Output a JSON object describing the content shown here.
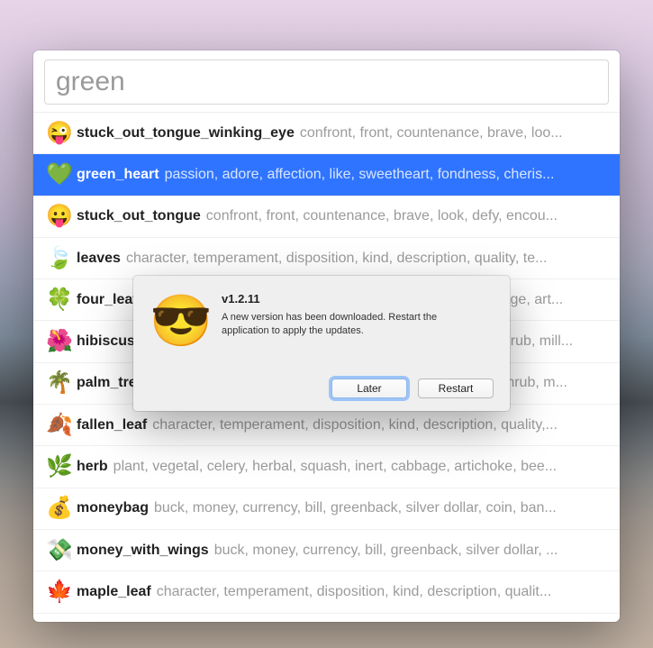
{
  "search": {
    "value": "green",
    "placeholder": ""
  },
  "rows": [
    {
      "emoji": "😜",
      "name": "stuck_out_tongue_winking_eye",
      "tags": "confront, front, countenance, brave, loo...",
      "selected": false
    },
    {
      "emoji": "💚",
      "name": "green_heart",
      "tags": "passion, adore, affection, like, sweetheart, fondness, cheris...",
      "selected": true
    },
    {
      "emoji": "😛",
      "name": "stuck_out_tongue",
      "tags": "confront, front, countenance, brave, look, defy, encou...",
      "selected": false
    },
    {
      "emoji": "🍃",
      "name": "leaves",
      "tags": "character, temperament, disposition, kind, description, quality, te...",
      "selected": false
    },
    {
      "emoji": "🍀",
      "name": "four_leaf_clover",
      "tags": "plant, vegetal, celery, herbal, squash, inert, cabbage, art...",
      "selected": false
    },
    {
      "emoji": "🌺",
      "name": "hibiscus",
      "tags": "rosiness, bush, pink, George Bush, crimson, chaparral, shrub, mill...",
      "selected": false
    },
    {
      "emoji": "🌴",
      "name": "palm_tree",
      "tags": "corner, works, shoetree, implant, flora, industrial plant, shrub, m...",
      "selected": false
    },
    {
      "emoji": "🍂",
      "name": "fallen_leaf",
      "tags": "character, temperament, disposition, kind, description, quality,...",
      "selected": false
    },
    {
      "emoji": "🌿",
      "name": "herb",
      "tags": "plant, vegetal, celery, herbal, squash, inert, cabbage, artichoke, bee...",
      "selected": false
    },
    {
      "emoji": "💰",
      "name": "moneybag",
      "tags": "buck, money, currency, bill, greenback, silver dollar, coin, ban...",
      "selected": false
    },
    {
      "emoji": "💸",
      "name": "money_with_wings",
      "tags": "buck, money, currency, bill, greenback, silver dollar, ...",
      "selected": false
    },
    {
      "emoji": "🍁",
      "name": "maple_leaf",
      "tags": "character, temperament, disposition, kind, description, qualit...",
      "selected": false
    }
  ],
  "dialog": {
    "icon": "😎",
    "title": "v1.2.11",
    "message": "A new version has been downloaded. Restart the application to apply the updates.",
    "later_label": "Later",
    "restart_label": "Restart"
  }
}
